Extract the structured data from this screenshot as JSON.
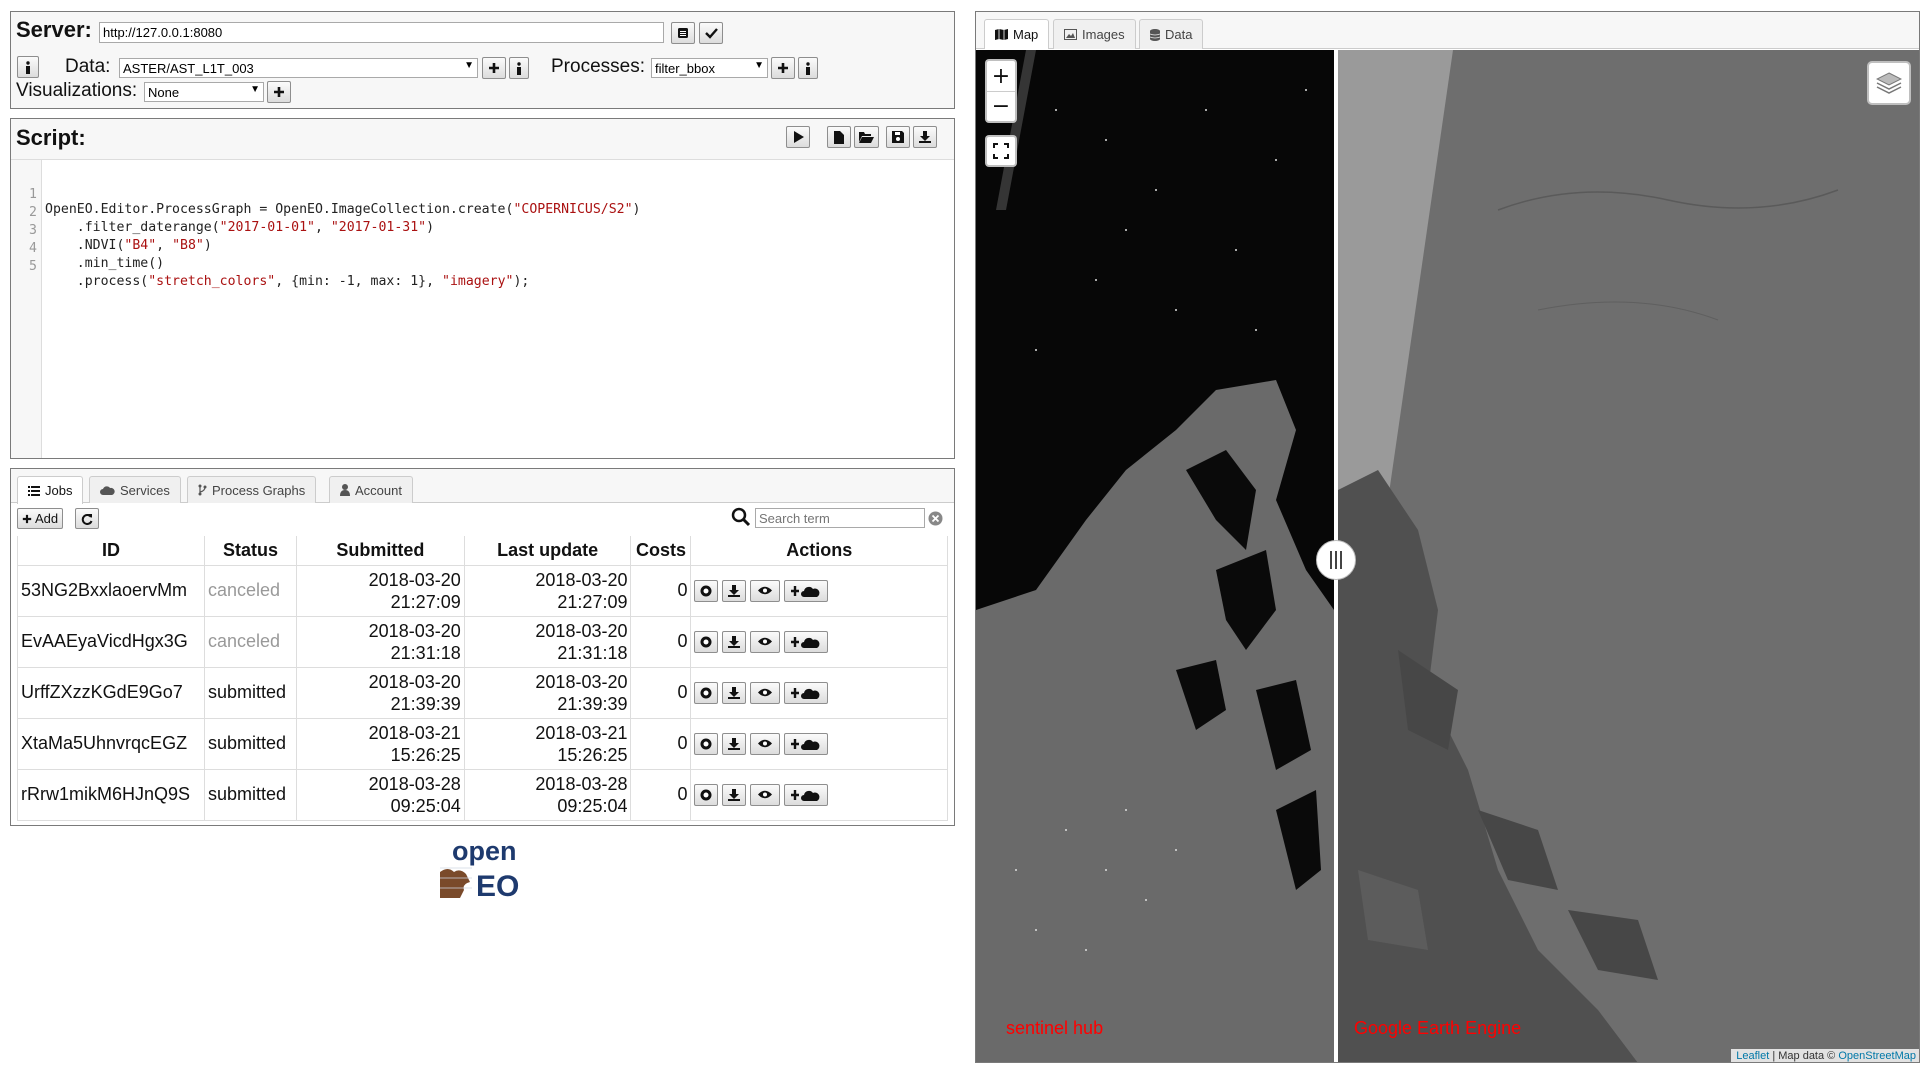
{
  "server": {
    "label": "Server:",
    "url": "http://127.0.0.1:8080"
  },
  "data": {
    "label": "Data:",
    "selected": "ASTER/AST_L1T_003"
  },
  "processes": {
    "label": "Processes:",
    "selected": "filter_bbox"
  },
  "visualizations": {
    "label": "Visualizations:",
    "selected": "None"
  },
  "script": {
    "title": "Script:",
    "lines": [
      {
        "num": "1",
        "code": "OpenEO.Editor.ProcessGraph = OpenEO.ImageCollection.create(\"COPERNICUS/S2\")"
      },
      {
        "num": "2",
        "code": "    .filter_daterange(\"2017-01-01\", \"2017-01-31\")"
      },
      {
        "num": "3",
        "code": "    .NDVI(\"B4\", \"B8\")"
      },
      {
        "num": "4",
        "code": "    .min_time()"
      },
      {
        "num": "5",
        "code": "    .process(\"stretch_colors\", {min: -1, max: 1}, \"imagery\");"
      }
    ]
  },
  "bottom_tabs": {
    "jobs": "Jobs",
    "services": "Services",
    "process_graphs": "Process Graphs",
    "account": "Account"
  },
  "jobs_toolbar": {
    "add_label": "Add",
    "search_placeholder": "Search term"
  },
  "jobs_table": {
    "headers": {
      "id": "ID",
      "status": "Status",
      "submitted": "Submitted",
      "last_update": "Last update",
      "costs": "Costs",
      "actions": "Actions"
    },
    "rows": [
      {
        "id": "53NG2BxxlaoervMm",
        "status": "canceled",
        "sub_date": "2018-03-20",
        "sub_time": "21:27:09",
        "upd_date": "2018-03-20",
        "upd_time": "21:27:09",
        "cost": "0"
      },
      {
        "id": "EvAAEyaVicdHgx3G",
        "status": "canceled",
        "sub_date": "2018-03-20",
        "sub_time": "21:31:18",
        "upd_date": "2018-03-20",
        "upd_time": "21:31:18",
        "cost": "0"
      },
      {
        "id": "UrffZXzzKGdE9Go7",
        "status": "submitted",
        "sub_date": "2018-03-20",
        "sub_time": "21:39:39",
        "upd_date": "2018-03-20",
        "upd_time": "21:39:39",
        "cost": "0"
      },
      {
        "id": "XtaMa5UhnvrqcEGZ",
        "status": "submitted",
        "sub_date": "2018-03-21",
        "sub_time": "15:26:25",
        "upd_date": "2018-03-21",
        "upd_time": "15:26:25",
        "cost": "0"
      },
      {
        "id": "rRrw1mikM6HJnQ9S",
        "status": "submitted",
        "sub_date": "2018-03-28",
        "sub_time": "09:25:04",
        "upd_date": "2018-03-28",
        "upd_time": "09:25:04",
        "cost": "0"
      }
    ]
  },
  "logo": {
    "line1": "open",
    "line2": "EO"
  },
  "map_tabs": {
    "map": "Map",
    "images": "Images",
    "data": "Data"
  },
  "map": {
    "left_label": "sentinel hub",
    "right_label": "Google Earth Engine",
    "attribution_leaflet": "Leaflet",
    "attribution_mid": "| Map data ©",
    "attribution_osm": "OpenStreetMap",
    "zoom_in": "+",
    "zoom_out": "−"
  },
  "colors": {
    "canceled_text": "#999999",
    "map_label": "#ff0000",
    "link": "#0078a8",
    "logo_blue": "#1e3a6e",
    "logo_brown": "#7a4a2a"
  },
  "icons": {
    "server_list": "list-icon",
    "server_connect": "check-icon",
    "info": "info-icon",
    "add": "plus-icon",
    "run": "play-icon",
    "new": "file-icon",
    "open": "folder-open-icon",
    "save": "save-icon",
    "download": "download-icon",
    "refresh": "refresh-icon",
    "search": "search-icon",
    "clear": "times-circle-icon",
    "job_status": "dot-circle-icon",
    "job_download": "download-icon",
    "job_view": "eye-icon",
    "job_publish": "cloud-plus-icon",
    "layers": "layers-icon",
    "fullscreen": "fullscreen-icon"
  }
}
